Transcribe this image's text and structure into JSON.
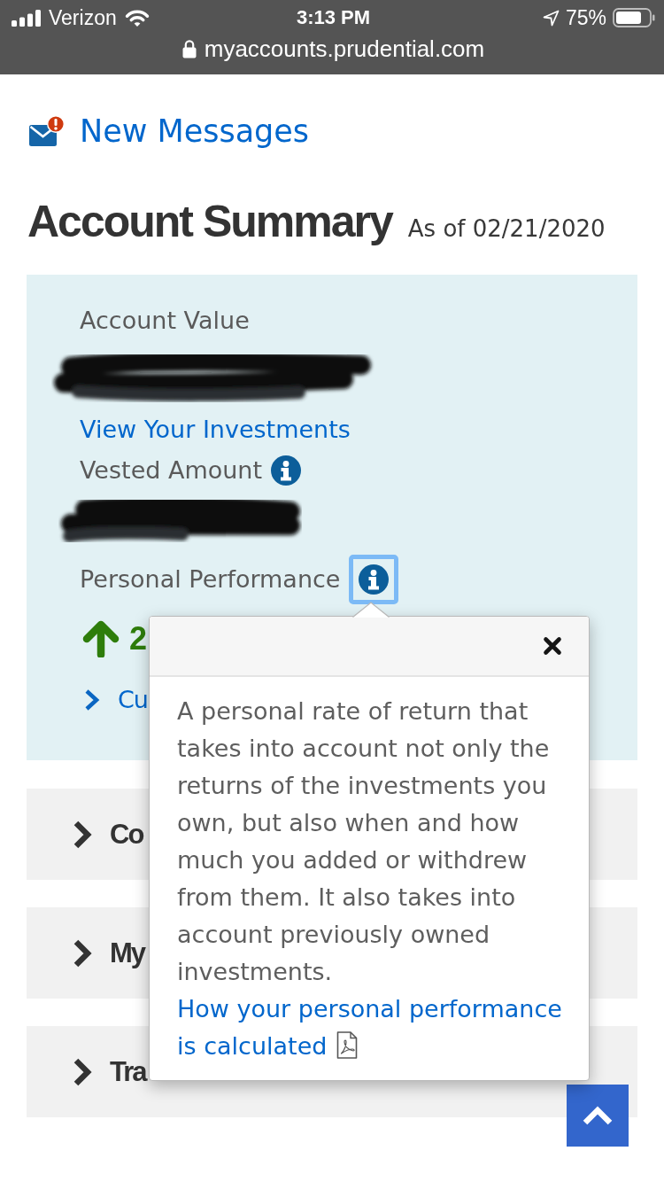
{
  "status_bar": {
    "carrier": "Verizon",
    "time": "3:13 PM",
    "battery": "75%",
    "url": "myaccounts.prudential.com"
  },
  "messages": {
    "label": "New Messages",
    "alert": true
  },
  "summary_header": {
    "title": "Account Summary",
    "as_of": "As of 02/21/2020"
  },
  "summary_card": {
    "items": [
      {
        "kind": "label",
        "text": "Account Value",
        "info": false
      },
      {
        "kind": "redacted"
      },
      {
        "kind": "link",
        "text": "View Your Investments"
      },
      {
        "kind": "label",
        "text": "Vested Amount",
        "info": true,
        "focused": false
      },
      {
        "kind": "redacted"
      },
      {
        "kind": "label",
        "text": "Personal Performance",
        "info": true,
        "focused": true
      },
      {
        "kind": "change",
        "text": "2",
        "positive": true
      },
      {
        "kind": "chevron_link",
        "text": "Cu"
      }
    ]
  },
  "popover": {
    "text": "A personal rate of return that takes into account not only the returns of the investments you own, but also when and how much you added or withdrew from them. It also takes into account previously owned investments.",
    "link": "How your personal performance is calculated"
  },
  "sections": [
    {
      "label": "Co",
      "expanded": false
    },
    {
      "label": "My",
      "expanded": false
    },
    {
      "label": "Tra",
      "expanded": false
    }
  ]
}
